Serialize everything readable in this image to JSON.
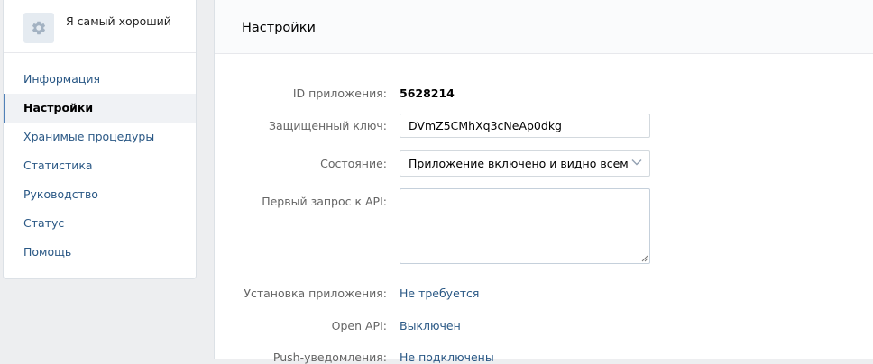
{
  "sidebar": {
    "app_name": "Я самый хороший",
    "items": [
      {
        "label": "Информация"
      },
      {
        "label": "Настройки"
      },
      {
        "label": "Хранимые процедуры"
      },
      {
        "label": "Статистика"
      },
      {
        "label": "Руководство"
      },
      {
        "label": "Статус"
      },
      {
        "label": "Помощь"
      }
    ],
    "active_item": "Настройки"
  },
  "main": {
    "title": "Настройки",
    "fields": {
      "app_id": {
        "label": "ID приложения:",
        "value": "5628214"
      },
      "secure_key": {
        "label": "Защищенный ключ:",
        "value": "DVmZ5CMhXq3cNeAp0dkg"
      },
      "state": {
        "label": "Состояние:",
        "value": "Приложение включено и видно всем"
      },
      "first_api_request": {
        "label": "Первый запрос к API:",
        "value": ""
      },
      "install": {
        "label": "Установка приложения:",
        "value": "Не требуется"
      },
      "open_api": {
        "label": "Open API:",
        "value": "Выключен"
      },
      "push": {
        "label": "Push-уведомления:",
        "value": "Не подключены"
      }
    }
  },
  "icons": {
    "app_icon": "gear-icon",
    "select_arrow": "chevron-down-icon",
    "textarea_resize": "resize-handle-icon"
  },
  "colors": {
    "link": "#2a5885",
    "accent": "#5181b8",
    "label": "#656565",
    "background": "#edeef0"
  }
}
